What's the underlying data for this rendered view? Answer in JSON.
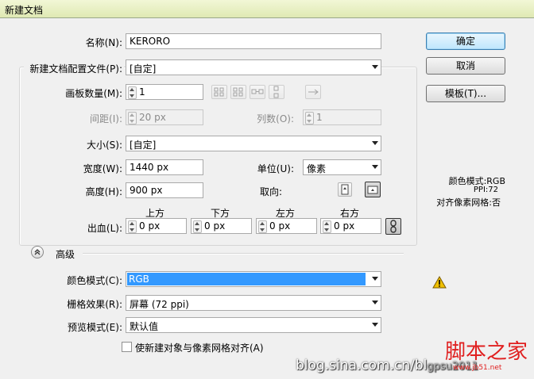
{
  "window": {
    "title": "新建文档"
  },
  "form": {
    "name_label": "名称(N):",
    "name_value": "KERORO",
    "profile_label": "新建文档配置文件(P):",
    "profile_value": "[自定]",
    "artboards_label": "画板数量(M):",
    "artboards_value": "1",
    "spacing_label": "间距(I):",
    "spacing_value": "20 px",
    "columns_label": "列数(O):",
    "columns_value": "1",
    "size_label": "大小(S):",
    "size_value": "[自定]",
    "width_label": "宽度(W):",
    "width_value": "1440 px",
    "units_label": "单位(U):",
    "units_value": "像素",
    "height_label": "高度(H):",
    "height_value": "900 px",
    "orientation_label": "取向:",
    "bleed_label": "出血(L):",
    "bleed_headers": [
      "上方",
      "下方",
      "左方",
      "右方"
    ],
    "bleed_values": [
      "0 px",
      "0 px",
      "0 px",
      "0 px"
    ],
    "advanced_label": "高级",
    "color_mode_label": "颜色模式(C):",
    "color_mode_value": "RGB",
    "raster_label": "栅格效果(R):",
    "raster_value": "屏幕 (72 ppi)",
    "preview_label": "预览模式(E):",
    "preview_value": "默认值",
    "align_checkbox_label": "使新建对象与像素网格对齐(A)"
  },
  "buttons": {
    "ok": "确定",
    "cancel": "取消",
    "templates": "模板(T)..."
  },
  "info": {
    "color_mode": "颜色模式:RGB",
    "ppi": "PPI:72",
    "align_grid": "对齐像素网格:否"
  },
  "watermarks": {
    "blog": "blog.sina.com.cn/bl",
    "blog_tail": "gpsu2011",
    "site_cn": "脚本之家",
    "site_en": "www.jb51.net"
  },
  "colors": {
    "selection": "#3399ff",
    "dialog_bg": "#f0f0f0",
    "warning": "#f0c000"
  }
}
